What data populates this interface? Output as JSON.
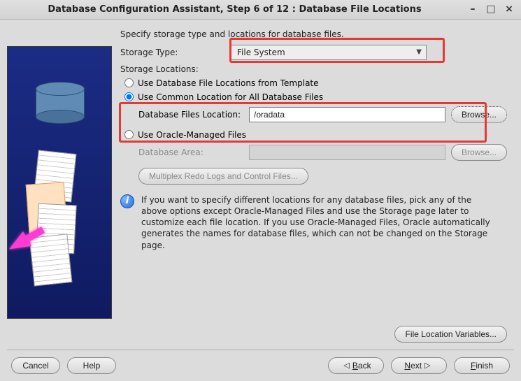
{
  "window": {
    "title": "Database Configuration Assistant, Step 6 of 12 : Database File Locations"
  },
  "main": {
    "instruction": "Specify storage type and locations for database files.",
    "storage_type_label": "Storage Type:",
    "storage_type_value": "File System",
    "storage_locations_label": "Storage Locations:",
    "radio_template": "Use Database File Locations from Template",
    "radio_common": "Use Common Location for All Database Files",
    "db_files_location_label": "Database Files Location:",
    "db_files_location_value": "/oradata",
    "browse1": "Browse...",
    "radio_omf": "Use Oracle-Managed Files",
    "db_area_label": "Database Area:",
    "db_area_value": "",
    "browse2": "Browse...",
    "multiplex_btn": "Multiplex Redo Logs and Control Files...",
    "info_text": "If you want to specify different locations for any database files, pick any of the above options except Oracle-Managed Files and use the Storage page later to customize each file location. If you use Oracle-Managed Files, Oracle automatically generates the names for database files, which can not be changed on the Storage page.",
    "file_loc_vars_btn": "File Location Variables..."
  },
  "footer": {
    "cancel": "Cancel",
    "help": "Help",
    "back": "Back",
    "next": "Next",
    "finish": "Finish"
  }
}
